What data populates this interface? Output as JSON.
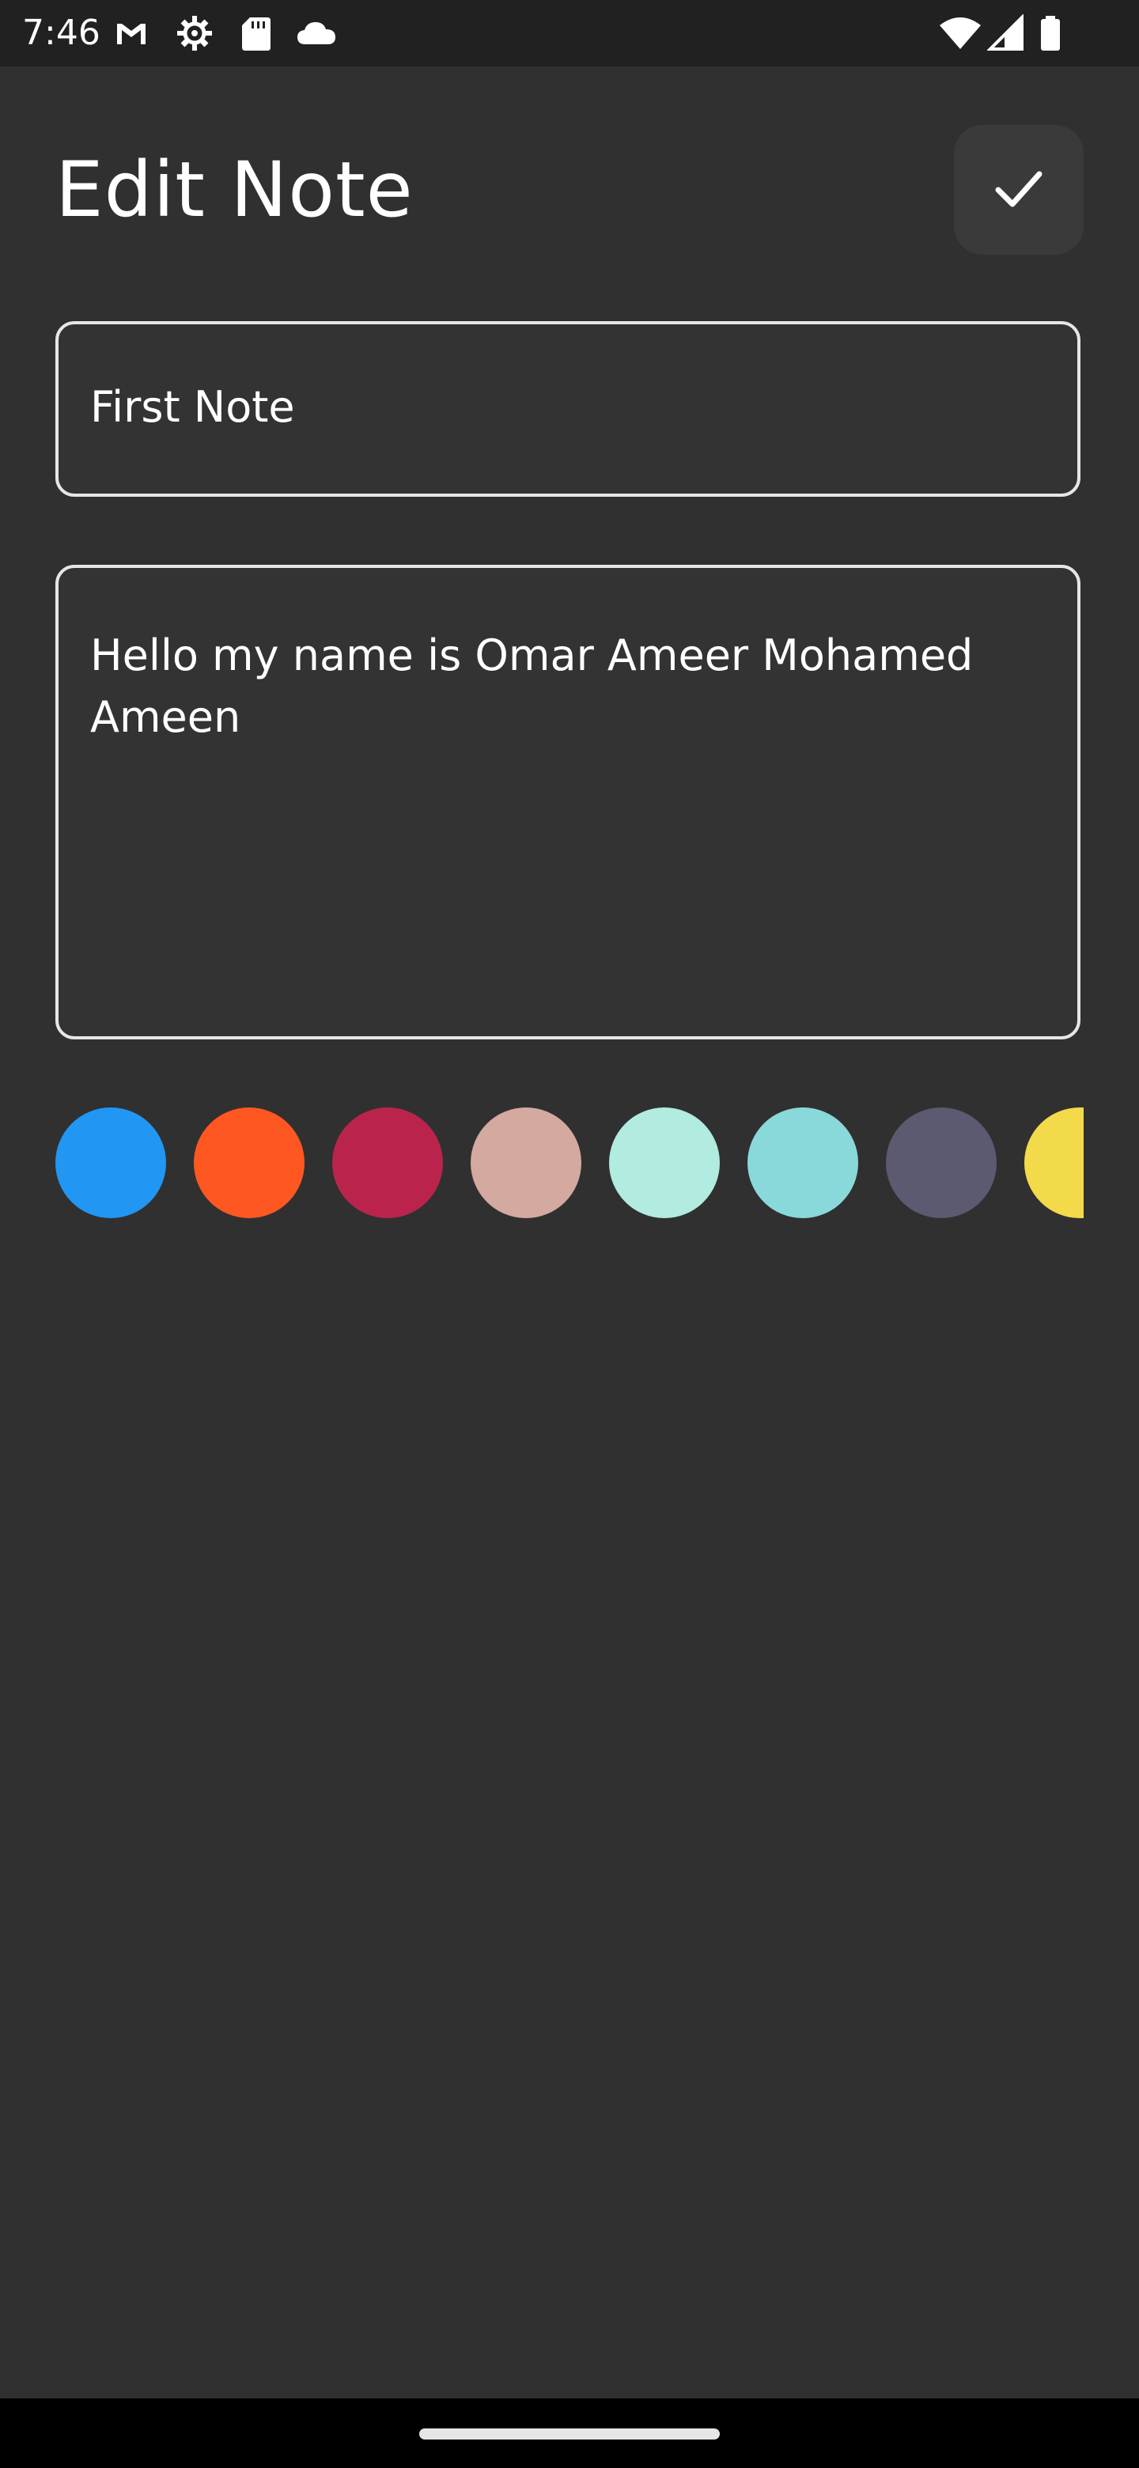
{
  "status_bar": {
    "time": "7:46",
    "left_icons": [
      "gmail-icon",
      "settings-icon",
      "sd-card-icon",
      "cloud-icon"
    ],
    "right_icons": [
      "wifi-icon",
      "signal-icon",
      "battery-icon"
    ]
  },
  "header": {
    "title": "Edit Note",
    "save_icon": "check-icon"
  },
  "form": {
    "title_value": "First Note",
    "content_value": "Hello my name is Omar Ameer Mohamed Ameen"
  },
  "colors": [
    "#2196F3",
    "#FF5722",
    "#BA244C",
    "#D3A9A0",
    "#B2EBE0",
    "#8AD9DA",
    "#5C5A70",
    "#F2DA4A"
  ],
  "theme": {
    "background": "#303030",
    "status_bar": "#212121",
    "border": "#E6E6E6"
  }
}
